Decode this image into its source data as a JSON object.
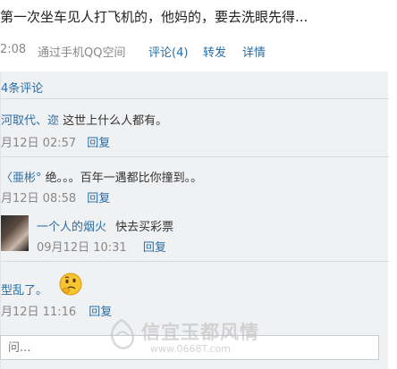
{
  "post": {
    "status_text": "第一次坐车见人打飞机的，他妈的，要去洗眼先得...",
    "time": "2:08",
    "via": "通过手机QQ空间",
    "comment_link": "评论(4)",
    "share_link": "转发",
    "detail_link": "详情"
  },
  "comments_panel": {
    "header": "4条评论",
    "items": [
      {
        "name": "河取代、迩",
        "text": "这世上什么人都有。",
        "time": "月12日 02:57",
        "reply": "回复"
      },
      {
        "name": "〈亜彬°",
        "text": "绝。。。百年一遇都比你撞到。。",
        "time": "月12日 08:58",
        "reply": "回复"
      },
      {
        "name": "型乱了。",
        "text": "",
        "time": "月12日 11:16",
        "reply": "回复"
      }
    ],
    "nested": {
      "name": "一个人的烟火",
      "text": "快去买彩票",
      "time": "09月12日 10:31",
      "reply": "回复"
    }
  },
  "input": {
    "placeholder": "问..."
  },
  "watermark": {
    "text": "信宜玉都风情",
    "url": "www.0668T.com"
  },
  "icons": {
    "avatar": "user-avatar",
    "emoji": "thinking-face-emoji",
    "watermark_logo": "watermark-logo-icon"
  }
}
